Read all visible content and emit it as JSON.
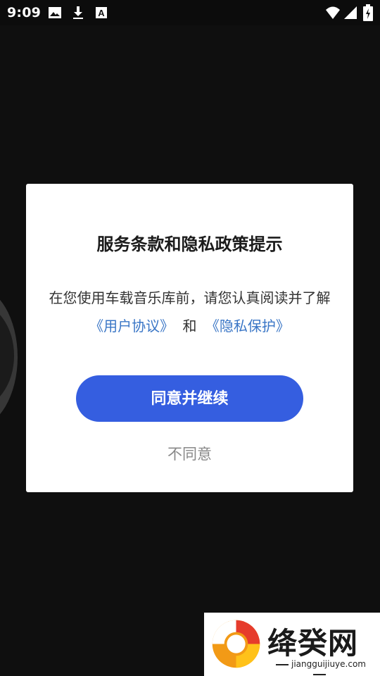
{
  "status_bar": {
    "time": "9:09",
    "left_icons": [
      "image-icon",
      "download-icon",
      "a-box-icon"
    ],
    "right_icons": [
      "wifi-icon",
      "signal-icon",
      "battery-icon"
    ]
  },
  "dialog": {
    "title": "服务条款和隐私政策提示",
    "body_line1": "在您使用车载音乐库前，请您认真阅读并了解",
    "user_agreement_link": "《用户协议》",
    "connector": "和",
    "privacy_link": "《隐私保护》",
    "agree_label": "同意并继续",
    "disagree_label": "不同意"
  },
  "watermark": {
    "title": "绛癸网",
    "domain": "jiangguijiuye.com"
  },
  "colors": {
    "primary_button": "#355ee0",
    "link": "#3a76c6",
    "background": "#101010"
  }
}
